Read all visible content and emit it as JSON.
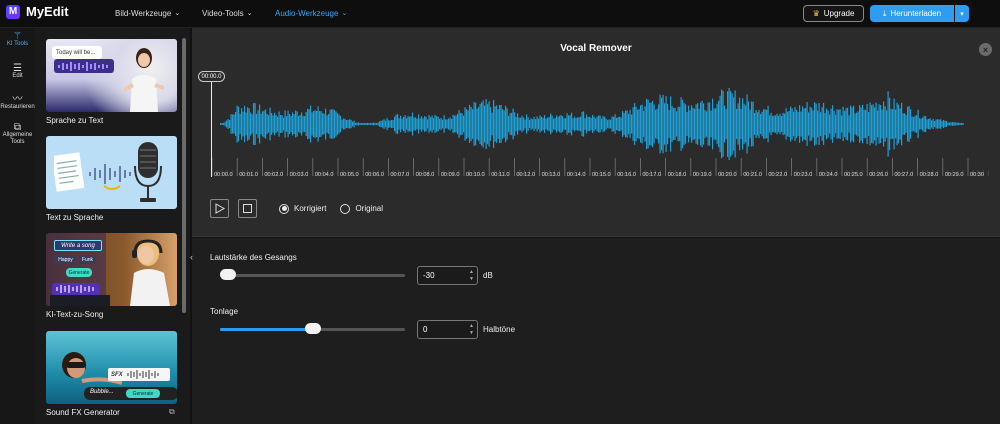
{
  "app": {
    "name": "MyEdit",
    "logo_letter": "M"
  },
  "nav": [
    {
      "label": "Bild-Werkzeuge",
      "active": false
    },
    {
      "label": "Video-Tools",
      "active": false
    },
    {
      "label": "Audio-Werkzeuge",
      "active": true
    }
  ],
  "header": {
    "upgrade_label": "Upgrade",
    "download_label": "Herunterladen"
  },
  "sidebar": [
    {
      "label": "KI Tools",
      "icon": "magic-wand-icon",
      "active": true
    },
    {
      "label": "Edit",
      "icon": "sliders-icon",
      "active": false
    },
    {
      "label": "Restaurieren",
      "icon": "waveform-icon",
      "active": false
    },
    {
      "label": "Allgemeine Tools",
      "icon": "copy-icon",
      "active": false
    }
  ],
  "tools": [
    {
      "caption": "Sprache zu Text",
      "thumb_text": "Today will be..."
    },
    {
      "caption": "Text zu Sprache"
    },
    {
      "caption": "KI-Text-zu-Song",
      "thumb_text": "Write a song",
      "chips": [
        "Happy",
        "Funk"
      ],
      "button": "Generate"
    },
    {
      "caption": "Sound FX Generator",
      "thumb_text": "SFX",
      "input": "Bubble...",
      "button": "Generate"
    }
  ],
  "editor": {
    "title": "Vocal Remover",
    "current_time": "00:00.0",
    "ruler_ticks": [
      "00:00.0",
      "00:01.0",
      "00:02.0",
      "00:03.0",
      "00:04.0",
      "00:05.0",
      "00:06.0",
      "00:07.0",
      "00:08.0",
      "00:09.0",
      "00:10.0",
      "00:11.0",
      "00:12.0",
      "00:13.0",
      "00:14.0",
      "00:15.0",
      "00:16.0",
      "00:17.0",
      "00:18.0",
      "00:19.0",
      "00:20.0",
      "00:21.0",
      "00:22.0",
      "00:23.0",
      "00:24.0",
      "00:25.0",
      "00:26.0",
      "00:27.0",
      "00:28.0",
      "00:29.0",
      "00:30"
    ],
    "mode_options": [
      "Korrigiert",
      "Original"
    ],
    "selected_mode": "Korrigiert",
    "waveform_color": "#1e9fd6"
  },
  "settings": {
    "volume": {
      "label": "Lautstärke des Gesangs",
      "value": "-30",
      "unit": "dB",
      "level": 0.0
    },
    "pitch": {
      "label": "Tonlage",
      "value": "0",
      "unit": "Halbtöne",
      "level": 0.5
    }
  },
  "colors": {
    "accent": "#2e9cf0",
    "active_nav": "#34a6ff"
  }
}
